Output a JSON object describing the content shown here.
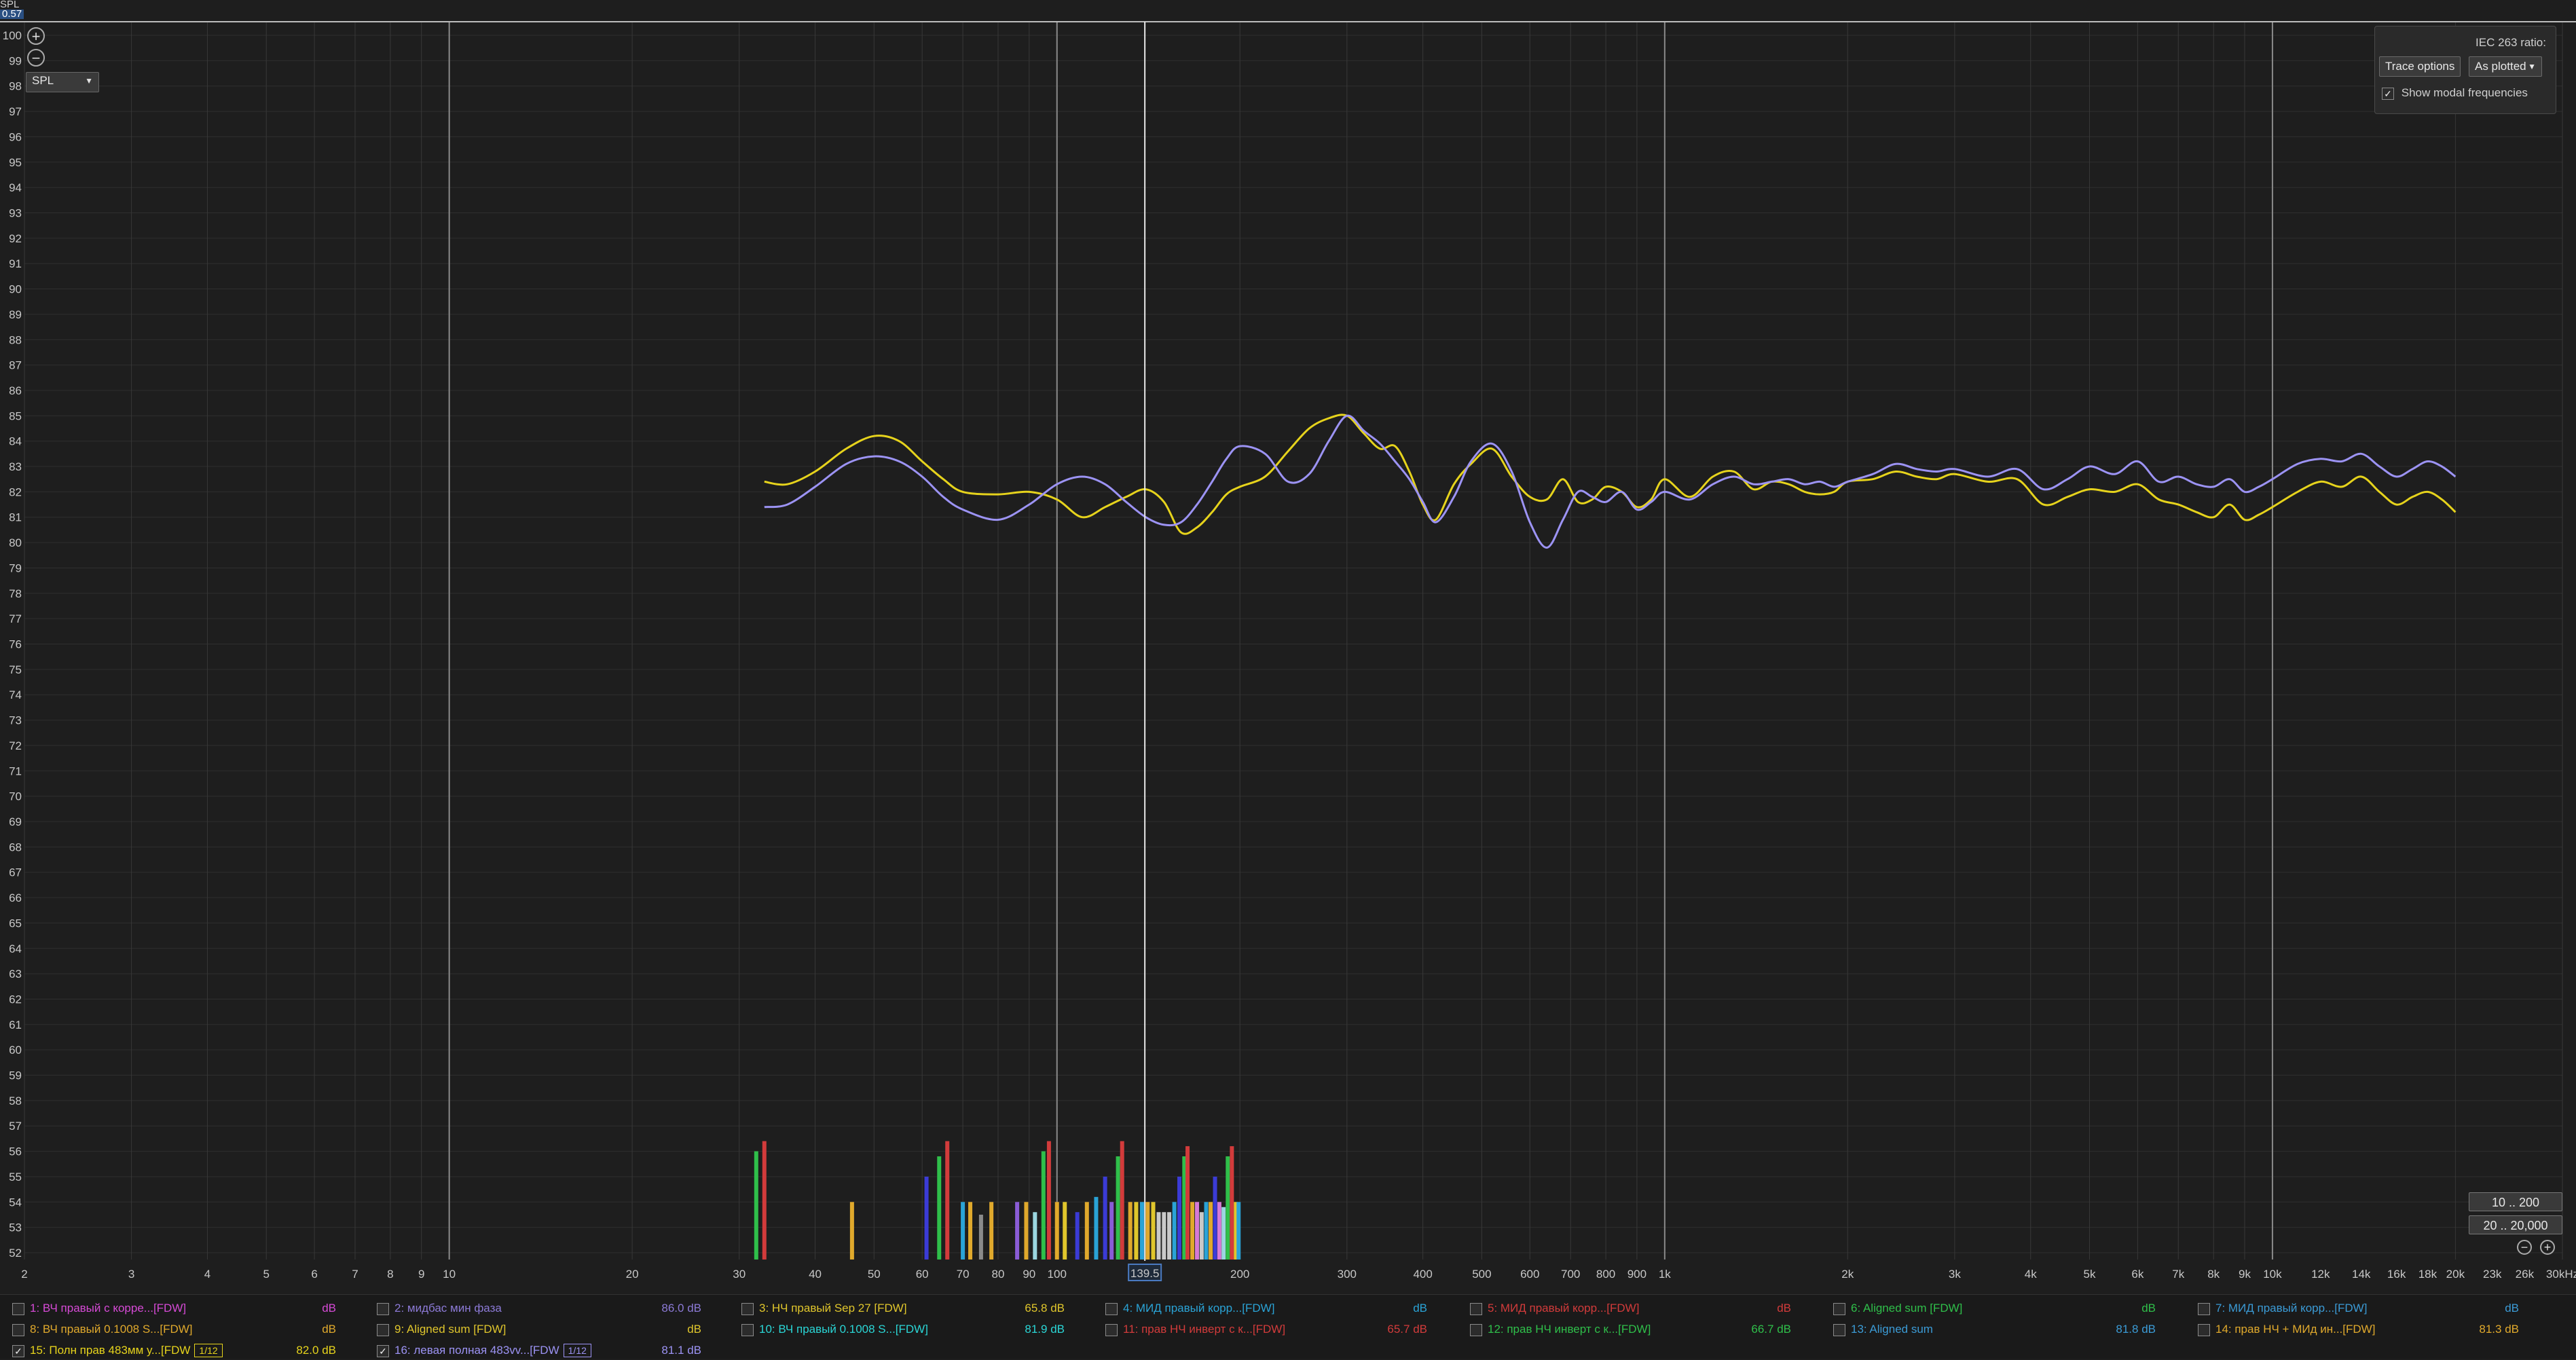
{
  "window": {
    "y_unit_label": "SPL",
    "y_cursor_value": "0.57",
    "y_scale_label": "SPL"
  },
  "cursor": {
    "freq_label": "139.5",
    "freq_hz": 139.5
  },
  "axis_labels": {
    "y_ticks": [
      "52",
      "53",
      "54",
      "55",
      "56",
      "57",
      "58",
      "59",
      "60",
      "61",
      "62",
      "63",
      "64",
      "65",
      "66",
      "67",
      "68",
      "69",
      "70",
      "71",
      "72",
      "73",
      "74",
      "75",
      "76",
      "77",
      "78",
      "79",
      "80",
      "81",
      "82",
      "83",
      "84",
      "85",
      "86",
      "87",
      "88",
      "89",
      "90",
      "91",
      "92",
      "93",
      "94",
      "95",
      "96",
      "97",
      "98",
      "99",
      "100"
    ],
    "x_ticks": [
      {
        "f": 2,
        "label": "2"
      },
      {
        "f": 3,
        "label": "3"
      },
      {
        "f": 4,
        "label": "4"
      },
      {
        "f": 5,
        "label": "5"
      },
      {
        "f": 6,
        "label": "6"
      },
      {
        "f": 7,
        "label": "7"
      },
      {
        "f": 8,
        "label": "8"
      },
      {
        "f": 9,
        "label": "9"
      },
      {
        "f": 10,
        "label": "10"
      },
      {
        "f": 20,
        "label": "20"
      },
      {
        "f": 30,
        "label": "30"
      },
      {
        "f": 40,
        "label": "40"
      },
      {
        "f": 50,
        "label": "50"
      },
      {
        "f": 60,
        "label": "60"
      },
      {
        "f": 70,
        "label": "70"
      },
      {
        "f": 80,
        "label": "80"
      },
      {
        "f": 90,
        "label": "90"
      },
      {
        "f": 100,
        "label": "100"
      },
      {
        "f": 200,
        "label": "200"
      },
      {
        "f": 300,
        "label": "300"
      },
      {
        "f": 400,
        "label": "400"
      },
      {
        "f": 500,
        "label": "500"
      },
      {
        "f": 600,
        "label": "600"
      },
      {
        "f": 700,
        "label": "700"
      },
      {
        "f": 800,
        "label": "800"
      },
      {
        "f": 900,
        "label": "900"
      },
      {
        "f": 1000,
        "label": "1k"
      },
      {
        "f": 2000,
        "label": "2k"
      },
      {
        "f": 3000,
        "label": "3k"
      },
      {
        "f": 4000,
        "label": "4k"
      },
      {
        "f": 5000,
        "label": "5k"
      },
      {
        "f": 6000,
        "label": "6k"
      },
      {
        "f": 7000,
        "label": "7k"
      },
      {
        "f": 8000,
        "label": "8k"
      },
      {
        "f": 9000,
        "label": "9k"
      },
      {
        "f": 10000,
        "label": "10k"
      },
      {
        "f": 12000,
        "label": "12k"
      },
      {
        "f": 14000,
        "label": "14k"
      },
      {
        "f": 16000,
        "label": "16k"
      },
      {
        "f": 18000,
        "label": "18k"
      },
      {
        "f": 20000,
        "label": "20k"
      },
      {
        "f": 23000,
        "label": "23k"
      },
      {
        "f": 26000,
        "label": "26k"
      },
      {
        "f": 30000,
        "label": "30kHz"
      }
    ]
  },
  "options_panel": {
    "iec_label": "IEC 263 ratio:",
    "trace_options_label": "Trace options",
    "plot_mode_value": "As plotted",
    "show_modal_label": "Show modal frequencies",
    "show_modal_checked": "✓"
  },
  "range_buttons": {
    "range1": "10 .. 200",
    "range2": "20 .. 20,000",
    "zoom_out": "−",
    "zoom_in": "+"
  },
  "chart_data": {
    "type": "line",
    "x_scale": "log",
    "xlim": [
      2,
      30000
    ],
    "ylim": [
      52,
      100
    ],
    "ylabel": "SPL",
    "grid": true,
    "series": [
      {
        "name": "15: Полн прав 483мм у...[FDW",
        "color": "#e6d31c",
        "x": [
          33,
          36,
          40,
          45,
          50,
          55,
          60,
          65,
          70,
          80,
          90,
          100,
          110,
          120,
          130,
          140,
          150,
          160,
          170,
          180,
          190,
          200,
          220,
          240,
          260,
          280,
          300,
          320,
          340,
          360,
          380,
          400,
          420,
          450,
          480,
          520,
          560,
          600,
          640,
          680,
          720,
          760,
          800,
          850,
          900,
          950,
          1000,
          1100,
          1200,
          1300,
          1400,
          1500,
          1600,
          1700,
          1800,
          1900,
          2000,
          2200,
          2400,
          2600,
          2800,
          3000,
          3400,
          3800,
          4200,
          4600,
          5000,
          5500,
          6000,
          6500,
          7000,
          7500,
          8000,
          8500,
          9000,
          9500,
          10000,
          11000,
          12000,
          13000,
          14000,
          15000,
          16000,
          17000,
          18000,
          19000,
          20000
        ],
        "y": [
          82.4,
          82.3,
          82.8,
          83.7,
          84.2,
          84.0,
          83.2,
          82.5,
          82.0,
          81.9,
          82.0,
          81.7,
          81.0,
          81.4,
          81.8,
          82.1,
          81.6,
          80.4,
          80.6,
          81.2,
          81.9,
          82.2,
          82.6,
          83.6,
          84.5,
          84.9,
          85.0,
          84.3,
          83.7,
          83.8,
          82.8,
          81.5,
          80.9,
          82.3,
          83.1,
          83.7,
          82.6,
          81.8,
          81.7,
          82.5,
          81.6,
          81.7,
          82.2,
          82.0,
          81.4,
          81.7,
          82.5,
          81.8,
          82.6,
          82.8,
          82.1,
          82.4,
          82.3,
          82.0,
          81.9,
          82.0,
          82.4,
          82.5,
          82.8,
          82.6,
          82.5,
          82.7,
          82.4,
          82.5,
          81.5,
          81.8,
          82.1,
          82.0,
          82.3,
          81.7,
          81.5,
          81.2,
          81.0,
          81.5,
          80.9,
          81.1,
          81.4,
          82.0,
          82.4,
          82.2,
          82.6,
          82.0,
          81.5,
          81.8,
          82.0,
          81.7,
          81.2
        ]
      },
      {
        "name": "16: левая полная 483vv...[FDW",
        "color": "#9c93f4",
        "x": [
          33,
          36,
          40,
          45,
          50,
          55,
          60,
          65,
          70,
          80,
          90,
          100,
          110,
          120,
          130,
          140,
          150,
          160,
          170,
          180,
          190,
          200,
          220,
          240,
          260,
          280,
          300,
          320,
          340,
          360,
          380,
          400,
          420,
          450,
          480,
          520,
          560,
          600,
          640,
          680,
          720,
          760,
          800,
          850,
          900,
          950,
          1000,
          1100,
          1200,
          1300,
          1400,
          1500,
          1600,
          1700,
          1800,
          1900,
          2000,
          2200,
          2400,
          2600,
          2800,
          3000,
          3400,
          3800,
          4200,
          4600,
          5000,
          5500,
          6000,
          6500,
          7000,
          7500,
          8000,
          8500,
          9000,
          9500,
          10000,
          11000,
          12000,
          13000,
          14000,
          15000,
          16000,
          17000,
          18000,
          19000,
          20000
        ],
        "y": [
          81.4,
          81.5,
          82.2,
          83.1,
          83.4,
          83.2,
          82.6,
          81.8,
          81.3,
          80.9,
          81.5,
          82.3,
          82.6,
          82.3,
          81.6,
          81.0,
          80.7,
          80.8,
          81.5,
          82.4,
          83.3,
          83.8,
          83.5,
          82.4,
          82.7,
          84.0,
          85.0,
          84.4,
          83.9,
          83.2,
          82.5,
          81.6,
          80.8,
          81.8,
          83.2,
          83.9,
          82.8,
          80.8,
          79.8,
          80.9,
          82.0,
          81.8,
          81.6,
          82.0,
          81.3,
          81.6,
          82.0,
          81.7,
          82.3,
          82.6,
          82.3,
          82.4,
          82.5,
          82.3,
          82.4,
          82.2,
          82.4,
          82.7,
          83.1,
          82.9,
          82.8,
          82.9,
          82.6,
          82.9,
          82.1,
          82.5,
          83.0,
          82.7,
          83.2,
          82.4,
          82.6,
          82.3,
          82.2,
          82.5,
          82.0,
          82.2,
          82.5,
          83.1,
          83.3,
          83.2,
          83.5,
          83.0,
          82.6,
          82.9,
          83.2,
          83.0,
          82.6
        ]
      }
    ],
    "modal_bars": [
      {
        "f": 32,
        "h": 56,
        "c": "#2fbf4a"
      },
      {
        "f": 33,
        "h": 56.4,
        "c": "#d23b3b"
      },
      {
        "f": 46,
        "h": 54,
        "c": "#e0a92c"
      },
      {
        "f": 61,
        "h": 55,
        "c": "#3b3bd6"
      },
      {
        "f": 64,
        "h": 55.8,
        "c": "#2fbf4a"
      },
      {
        "f": 66,
        "h": 56.4,
        "c": "#d23b3b"
      },
      {
        "f": 70,
        "h": 54,
        "c": "#2aa3d6"
      },
      {
        "f": 72,
        "h": 54,
        "c": "#e0a92c"
      },
      {
        "f": 75,
        "h": 53.5,
        "c": "#8a8a8a"
      },
      {
        "f": 78,
        "h": 54,
        "c": "#e0a92c"
      },
      {
        "f": 86,
        "h": 54,
        "c": "#8a5cd6"
      },
      {
        "f": 89,
        "h": 54,
        "c": "#e0a92c"
      },
      {
        "f": 92,
        "h": 53.6,
        "c": "#9bd6e0"
      },
      {
        "f": 95,
        "h": 56,
        "c": "#2fbf4a"
      },
      {
        "f": 97,
        "h": 56.4,
        "c": "#d23b3b"
      },
      {
        "f": 100,
        "h": 54,
        "c": "#e0a92c"
      },
      {
        "f": 103,
        "h": 54,
        "c": "#e0c62c"
      },
      {
        "f": 108,
        "h": 53.6,
        "c": "#3b3bd6"
      },
      {
        "f": 112,
        "h": 54,
        "c": "#e0a92c"
      },
      {
        "f": 116,
        "h": 54.2,
        "c": "#2aa3d6"
      },
      {
        "f": 120,
        "h": 55,
        "c": "#3b3bd6"
      },
      {
        "f": 123,
        "h": 54,
        "c": "#8a5cd6"
      },
      {
        "f": 126,
        "h": 55.8,
        "c": "#2fbf4a"
      },
      {
        "f": 128,
        "h": 56.4,
        "c": "#d23b3b"
      },
      {
        "f": 132,
        "h": 54,
        "c": "#e0a92c"
      },
      {
        "f": 135,
        "h": 54,
        "c": "#e0c62c"
      },
      {
        "f": 138,
        "h": 54,
        "c": "#2aa3d6"
      },
      {
        "f": 141,
        "h": 54,
        "c": "#e0a92c"
      },
      {
        "f": 144,
        "h": 54,
        "c": "#e0c62c"
      },
      {
        "f": 147,
        "h": 53.6,
        "c": "#c9c9c9"
      },
      {
        "f": 150,
        "h": 53.6,
        "c": "#c9c9c9"
      },
      {
        "f": 153,
        "h": 53.6,
        "c": "#c9c9c9"
      },
      {
        "f": 156,
        "h": 54,
        "c": "#2aa3d6"
      },
      {
        "f": 159,
        "h": 55,
        "c": "#3b3bd6"
      },
      {
        "f": 162,
        "h": 55.8,
        "c": "#2fbf4a"
      },
      {
        "f": 164,
        "h": 56.2,
        "c": "#d23b3b"
      },
      {
        "f": 167,
        "h": 54,
        "c": "#e0a92c"
      },
      {
        "f": 170,
        "h": 54,
        "c": "#d57ad6"
      },
      {
        "f": 173,
        "h": 53.6,
        "c": "#c9c9c9"
      },
      {
        "f": 176,
        "h": 54,
        "c": "#2aa3d6"
      },
      {
        "f": 179,
        "h": 54,
        "c": "#e0a92c"
      },
      {
        "f": 182,
        "h": 55,
        "c": "#3b3bd6"
      },
      {
        "f": 185,
        "h": 54,
        "c": "#d57ad6"
      },
      {
        "f": 188,
        "h": 53.8,
        "c": "#9bd6e0"
      },
      {
        "f": 191,
        "h": 55.8,
        "c": "#2fbf4a"
      },
      {
        "f": 194,
        "h": 56.2,
        "c": "#d23b3b"
      },
      {
        "f": 197,
        "h": 54,
        "c": "#e0c62c"
      },
      {
        "f": 199,
        "h": 54,
        "c": "#2aa3d6"
      }
    ]
  },
  "traces": [
    {
      "label": "1: ВЧ правый с корре...[FDW]",
      "db": "dB",
      "color": "#d64ad6",
      "checked": ""
    },
    {
      "label": "2: мидбас мин фаза",
      "db": "86.0 dB",
      "color": "#8c7ad6",
      "checked": ""
    },
    {
      "label": "3: НЧ правый Sep 27 [FDW]",
      "db": "65.8 dB",
      "color": "#e0c62c",
      "checked": ""
    },
    {
      "label": "4: МИД правый корр...[FDW]",
      "db": "dB",
      "color": "#2aa3d6",
      "checked": ""
    },
    {
      "label": "5: МИД правый корр...[FDW]",
      "db": "dB",
      "color": "#d23b3b",
      "checked": ""
    },
    {
      "label": "6: Aligned sum [FDW]",
      "db": "dB",
      "color": "#2fbf4a",
      "checked": ""
    },
    {
      "label": "7: МИД правый корр...[FDW]",
      "db": "dB",
      "color": "#3b9bd6",
      "checked": ""
    },
    {
      "label": "8: ВЧ правый 0.1008 S...[FDW]",
      "db": "dB",
      "color": "#e0a92c",
      "checked": ""
    },
    {
      "label": "9: Aligned sum [FDW]",
      "db": "dB",
      "color": "#e0c62c",
      "checked": ""
    },
    {
      "label": "10: ВЧ правый 0.1008 S...[FDW]",
      "db": "81.9 dB",
      "color": "#2ad6d6",
      "checked": ""
    },
    {
      "label": "11: прав НЧ  инверт с к...[FDW]",
      "db": "65.7 dB",
      "color": "#d23b3b",
      "checked": ""
    },
    {
      "label": "12: прав НЧ  инверт с к...[FDW]",
      "db": "66.7 dB",
      "color": "#2fbf4a",
      "checked": ""
    },
    {
      "label": "13: Aligned sum",
      "db": "81.8 dB",
      "color": "#3b9bd6",
      "checked": ""
    },
    {
      "label": "14: прав НЧ + МИд ин...[FDW]",
      "db": "81.3 dB",
      "color": "#e0a92c",
      "checked": ""
    },
    {
      "label": "15: Полн прав 483мм у...[FDW",
      "db": "82.0 dB",
      "color": "#e6d31c",
      "checked": "✓",
      "smooth": "1/12"
    },
    {
      "label": "16: левая полная 483vv...[FDW",
      "db": "81.1 dB",
      "color": "#9c93f4",
      "checked": "✓",
      "smooth": "1/12"
    }
  ]
}
